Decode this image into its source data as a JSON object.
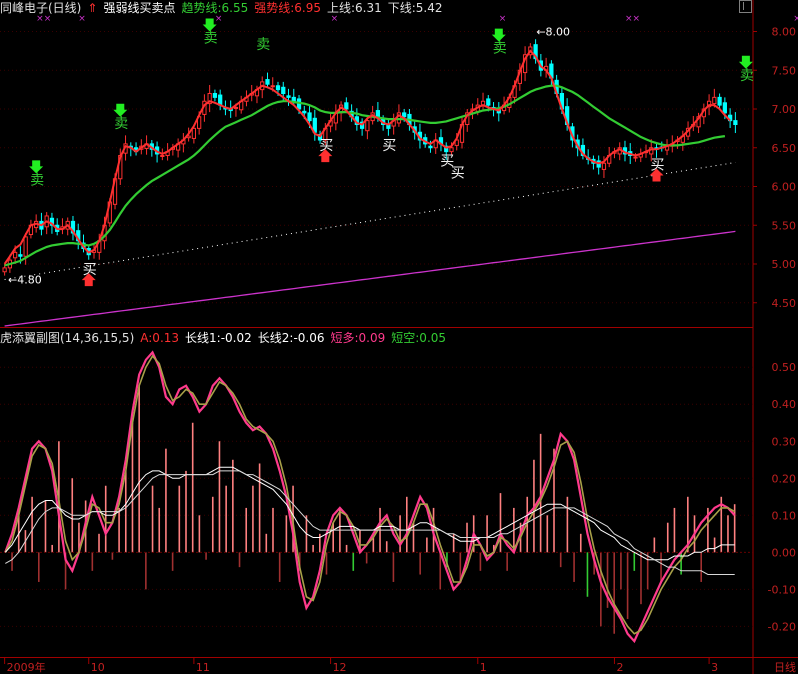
{
  "header": {
    "stock": "同峰电子(日线)",
    "indicator": "强弱线买卖点",
    "trend_label": "趋势线:6.55",
    "strong_label": "强势线:6.95",
    "upper_label": "上线:6.31",
    "lower_label": "下线:5.42"
  },
  "subheader": {
    "name": "虎添翼副图(14,36,15,5)",
    "a": "A:0.13",
    "long1": "长线1:-0.02",
    "long2": "长线2:-0.06",
    "short_long": "短多:0.09",
    "short_short": "短空:0.05"
  },
  "colors": {
    "up": "#ff3030",
    "down": "#00ffff",
    "trend": "#33cc33",
    "strong": "#ff3030",
    "purple": "#cc33cc",
    "white": "#ffffff",
    "pink": "#ff3a8c",
    "olive": "#a8a048",
    "label": "#f0f0f0",
    "buy_arrow": "#ff3030",
    "sell_arrow": "#22ee22"
  },
  "chart_data": [
    {
      "type": "candlestick",
      "title": "强弱线买卖点",
      "ylim": [
        4.2,
        8.2
      ],
      "y_ticks": [
        "8.00",
        "7.50",
        "7.00",
        "6.50",
        "6.00",
        "5.50",
        "5.00",
        "4.50"
      ],
      "x_ticks": [
        "2009年",
        "10",
        "11",
        "12",
        "1",
        "2",
        "3"
      ],
      "x_tick_index": [
        0,
        16,
        36,
        62,
        90,
        116,
        134
      ],
      "high_marker": "8.00",
      "low_marker": "4.80",
      "signals": [
        {
          "label": "卖",
          "index": 6,
          "value": 5.95,
          "arrow": "sell"
        },
        {
          "label": "买",
          "index": 16,
          "value": 5.05,
          "arrow": "buy"
        },
        {
          "label": "卖",
          "index": 22,
          "value": 6.68,
          "arrow": "sell"
        },
        {
          "label": "卖",
          "index": 39,
          "value": 7.78,
          "arrow": "sell"
        },
        {
          "label": "卖",
          "index": 49,
          "value": 7.7,
          "arrow": "none"
        },
        {
          "label": "买",
          "index": 61,
          "value": 6.65,
          "arrow": "buy"
        },
        {
          "label": "买",
          "index": 73,
          "value": 6.65,
          "arrow": "none"
        },
        {
          "label": "买",
          "index": 84,
          "value": 6.45,
          "arrow": "none"
        },
        {
          "label": "买",
          "index": 86,
          "value": 6.3,
          "arrow": "none"
        },
        {
          "label": "卖",
          "index": 94,
          "value": 7.65,
          "arrow": "sell"
        },
        {
          "label": "买",
          "index": 124,
          "value": 6.4,
          "arrow": "buy"
        },
        {
          "label": "卖",
          "index": 141,
          "value": 7.3,
          "arrow": "sell"
        }
      ],
      "close": [
        4.95,
        5.05,
        5.15,
        5.1,
        5.35,
        5.5,
        5.55,
        5.45,
        5.62,
        5.5,
        5.42,
        5.48,
        5.55,
        5.4,
        5.3,
        5.2,
        5.12,
        5.18,
        5.3,
        5.5,
        5.8,
        6.1,
        6.4,
        6.55,
        6.5,
        6.45,
        6.52,
        6.55,
        6.48,
        6.42,
        6.4,
        6.45,
        6.5,
        6.55,
        6.6,
        6.65,
        6.75,
        6.9,
        7.1,
        7.2,
        7.15,
        7.05,
        7.0,
        6.98,
        7.02,
        7.1,
        7.15,
        7.2,
        7.25,
        7.35,
        7.32,
        7.3,
        7.25,
        7.2,
        7.15,
        7.1,
        7.0,
        6.95,
        6.85,
        6.7,
        6.6,
        6.75,
        6.85,
        6.95,
        7.05,
        7.0,
        6.9,
        6.8,
        6.75,
        6.85,
        6.95,
        6.9,
        6.8,
        6.75,
        6.85,
        6.95,
        6.9,
        6.8,
        6.7,
        6.6,
        6.55,
        6.5,
        6.6,
        6.55,
        6.45,
        6.5,
        6.6,
        6.8,
        6.95,
        7.0,
        7.05,
        7.1,
        7.05,
        7.0,
        6.95,
        7.05,
        7.15,
        7.3,
        7.5,
        7.7,
        7.8,
        7.65,
        7.5,
        7.55,
        7.4,
        7.2,
        7.0,
        6.8,
        6.6,
        6.5,
        6.4,
        6.35,
        6.3,
        6.25,
        6.3,
        6.4,
        6.45,
        6.5,
        6.42,
        6.4,
        6.38,
        6.42,
        6.45,
        6.5,
        6.48,
        6.5,
        6.52,
        6.55,
        6.6,
        6.65,
        6.75,
        6.8,
        6.9,
        7.0,
        7.1,
        7.15,
        7.05,
        6.95,
        6.85,
        6.8
      ],
      "strong_line": [
        5.0,
        5.1,
        5.2,
        5.25,
        5.38,
        5.5,
        5.52,
        5.5,
        5.55,
        5.52,
        5.45,
        5.45,
        5.5,
        5.42,
        5.32,
        5.22,
        5.15,
        5.18,
        5.3,
        5.5,
        5.8,
        6.1,
        6.38,
        6.52,
        6.5,
        6.45,
        6.5,
        6.55,
        6.5,
        6.45,
        6.42,
        6.45,
        6.5,
        6.55,
        6.6,
        6.68,
        6.78,
        6.92,
        7.05,
        7.1,
        7.08,
        7.05,
        7.02,
        7.0,
        7.05,
        7.1,
        7.15,
        7.2,
        7.25,
        7.3,
        7.28,
        7.25,
        7.2,
        7.15,
        7.1,
        7.05,
        6.98,
        6.9,
        6.8,
        6.68,
        6.65,
        6.75,
        6.85,
        6.95,
        7.02,
        6.98,
        6.9,
        6.82,
        6.8,
        6.88,
        6.92,
        6.88,
        6.82,
        6.8,
        6.85,
        6.92,
        6.88,
        6.8,
        6.72,
        6.62,
        6.58,
        6.55,
        6.6,
        6.55,
        6.5,
        6.52,
        6.62,
        6.8,
        6.92,
        6.98,
        7.02,
        7.05,
        7.02,
        7.0,
        6.98,
        7.05,
        7.15,
        7.3,
        7.48,
        7.65,
        7.75,
        7.68,
        7.55,
        7.5,
        7.4,
        7.2,
        7.0,
        6.82,
        6.65,
        6.52,
        6.42,
        6.36,
        6.32,
        6.3,
        6.32,
        6.4,
        6.45,
        6.48,
        6.44,
        6.42,
        6.4,
        6.42,
        6.45,
        6.48,
        6.48,
        6.5,
        6.52,
        6.55,
        6.6,
        6.65,
        6.72,
        6.8,
        6.88,
        6.98,
        7.05,
        7.05,
        7.0,
        6.92,
        6.85
      ],
      "trend_line": [
        4.98,
        5.0,
        5.02,
        5.04,
        5.08,
        5.12,
        5.16,
        5.19,
        5.22,
        5.24,
        5.25,
        5.26,
        5.27,
        5.27,
        5.26,
        5.25,
        5.24,
        5.26,
        5.3,
        5.36,
        5.44,
        5.54,
        5.65,
        5.75,
        5.83,
        5.9,
        5.96,
        6.02,
        6.07,
        6.11,
        6.15,
        6.19,
        6.23,
        6.27,
        6.31,
        6.35,
        6.4,
        6.46,
        6.53,
        6.6,
        6.66,
        6.72,
        6.77,
        6.8,
        6.83,
        6.86,
        6.89,
        6.92,
        6.96,
        7.0,
        7.04,
        7.07,
        7.09,
        7.1,
        7.1,
        7.09,
        7.08,
        7.07,
        7.05,
        7.02,
        6.98,
        6.96,
        6.95,
        6.95,
        6.96,
        6.96,
        6.95,
        6.94,
        6.92,
        6.91,
        6.9,
        6.89,
        6.88,
        6.87,
        6.87,
        6.87,
        6.87,
        6.86,
        6.85,
        6.84,
        6.83,
        6.82,
        6.82,
        6.83,
        6.84,
        6.86,
        6.88,
        6.9,
        6.92,
        6.94,
        6.96,
        6.98,
        6.99,
        7.0,
        7.01,
        7.03,
        7.06,
        7.1,
        7.14,
        7.18,
        7.22,
        7.25,
        7.27,
        7.29,
        7.3,
        7.3,
        7.28,
        7.25,
        7.22,
        7.18,
        7.13,
        7.08,
        7.03,
        6.98,
        6.93,
        6.88,
        6.84,
        6.8,
        6.76,
        6.72,
        6.68,
        6.64,
        6.61,
        6.58,
        6.56,
        6.54,
        6.53,
        6.53,
        6.53,
        6.54,
        6.55,
        6.56,
        6.57,
        6.59,
        6.61,
        6.63,
        6.64,
        6.65
      ],
      "upper_line": [
        4.8,
        6.31
      ],
      "lower_line": [
        4.2,
        5.42
      ]
    },
    {
      "type": "oscillator",
      "title": "虎添翼副图(14,36,15,5)",
      "ylim": [
        -0.28,
        0.56
      ],
      "y_ticks": [
        "0.50",
        "0.40",
        "0.30",
        "0.20",
        "0.10",
        "0.00",
        "-0.10",
        "-0.20"
      ],
      "series": [
        {
          "name": "短多",
          "values": [
            0.0,
            0.05,
            0.12,
            0.2,
            0.28,
            0.3,
            0.28,
            0.22,
            0.1,
            -0.02,
            -0.05,
            0.0,
            0.08,
            0.15,
            0.1,
            0.05,
            0.08,
            0.15,
            0.25,
            0.38,
            0.48,
            0.52,
            0.54,
            0.5,
            0.42,
            0.4,
            0.44,
            0.45,
            0.42,
            0.38,
            0.4,
            0.45,
            0.47,
            0.45,
            0.42,
            0.38,
            0.35,
            0.33,
            0.34,
            0.32,
            0.28,
            0.22,
            0.15,
            0.05,
            -0.08,
            -0.15,
            -0.12,
            -0.05,
            0.05,
            0.1,
            0.12,
            0.1,
            0.05,
            0.0,
            0.02,
            0.05,
            0.08,
            0.1,
            0.05,
            0.02,
            0.05,
            0.1,
            0.15,
            0.12,
            0.05,
            0.0,
            -0.05,
            -0.1,
            -0.08,
            -0.02,
            0.05,
            0.02,
            -0.02,
            0.0,
            0.05,
            0.02,
            0.0,
            0.05,
            0.1,
            0.12,
            0.15,
            0.2,
            0.25,
            0.32,
            0.3,
            0.25,
            0.15,
            0.05,
            -0.02,
            -0.08,
            -0.12,
            -0.15,
            -0.18,
            -0.22,
            -0.24,
            -0.2,
            -0.16,
            -0.12,
            -0.08,
            -0.05,
            -0.02,
            0.0,
            0.02,
            0.05,
            0.08,
            0.1,
            0.12,
            0.13,
            0.12,
            0.1
          ]
        },
        {
          "name": "短空",
          "values": [
            0.0,
            0.03,
            0.1,
            0.18,
            0.26,
            0.29,
            0.28,
            0.24,
            0.14,
            0.03,
            -0.02,
            0.0,
            0.06,
            0.13,
            0.12,
            0.08,
            0.08,
            0.13,
            0.22,
            0.35,
            0.45,
            0.5,
            0.53,
            0.51,
            0.45,
            0.41,
            0.42,
            0.44,
            0.43,
            0.4,
            0.4,
            0.43,
            0.46,
            0.45,
            0.43,
            0.4,
            0.36,
            0.34,
            0.33,
            0.32,
            0.3,
            0.25,
            0.18,
            0.08,
            -0.04,
            -0.12,
            -0.13,
            -0.08,
            0.02,
            0.08,
            0.11,
            0.1,
            0.07,
            0.02,
            0.02,
            0.04,
            0.07,
            0.09,
            0.07,
            0.03,
            0.04,
            0.08,
            0.13,
            0.13,
            0.08,
            0.02,
            -0.03,
            -0.08,
            -0.08,
            -0.04,
            0.02,
            0.02,
            -0.01,
            0.0,
            0.04,
            0.03,
            0.01,
            0.04,
            0.08,
            0.11,
            0.14,
            0.18,
            0.23,
            0.29,
            0.3,
            0.27,
            0.19,
            0.09,
            0.01,
            -0.05,
            -0.1,
            -0.14,
            -0.17,
            -0.2,
            -0.22,
            -0.21,
            -0.18,
            -0.14,
            -0.1,
            -0.07,
            -0.04,
            -0.02,
            0.01,
            0.03,
            0.06,
            0.08,
            0.1,
            0.12,
            0.12,
            0.11
          ]
        },
        {
          "name": "长线1",
          "values": [
            0.0,
            0.02,
            0.05,
            0.08,
            0.11,
            0.13,
            0.14,
            0.14,
            0.12,
            0.1,
            0.09,
            0.09,
            0.1,
            0.11,
            0.11,
            0.1,
            0.1,
            0.11,
            0.13,
            0.16,
            0.19,
            0.21,
            0.22,
            0.22,
            0.21,
            0.2,
            0.2,
            0.21,
            0.21,
            0.21,
            0.21,
            0.22,
            0.23,
            0.23,
            0.23,
            0.22,
            0.21,
            0.2,
            0.19,
            0.18,
            0.17,
            0.15,
            0.13,
            0.1,
            0.07,
            0.05,
            0.04,
            0.04,
            0.05,
            0.06,
            0.07,
            0.07,
            0.07,
            0.06,
            0.06,
            0.06,
            0.07,
            0.07,
            0.07,
            0.06,
            0.06,
            0.07,
            0.08,
            0.08,
            0.07,
            0.06,
            0.05,
            0.04,
            0.03,
            0.03,
            0.03,
            0.04,
            0.04,
            0.05,
            0.06,
            0.07,
            0.08,
            0.09,
            0.1,
            0.11,
            0.12,
            0.13,
            0.13,
            0.13,
            0.12,
            0.11,
            0.1,
            0.09,
            0.08,
            0.06,
            0.05,
            0.04,
            0.02,
            0.01,
            0.0,
            -0.01,
            -0.02,
            -0.02,
            -0.02,
            -0.02,
            -0.01,
            -0.01,
            -0.01,
            0.0,
            0.0,
            0.01,
            0.01,
            0.02,
            0.02,
            0.02
          ]
        },
        {
          "name": "长线2",
          "values": [
            -0.03,
            -0.02,
            0.0,
            0.03,
            0.06,
            0.09,
            0.11,
            0.12,
            0.12,
            0.11,
            0.1,
            0.1,
            0.1,
            0.11,
            0.11,
            0.11,
            0.11,
            0.11,
            0.12,
            0.14,
            0.16,
            0.18,
            0.2,
            0.21,
            0.21,
            0.21,
            0.21,
            0.21,
            0.21,
            0.21,
            0.21,
            0.21,
            0.22,
            0.22,
            0.22,
            0.22,
            0.21,
            0.21,
            0.2,
            0.19,
            0.18,
            0.17,
            0.15,
            0.13,
            0.11,
            0.09,
            0.07,
            0.06,
            0.06,
            0.06,
            0.06,
            0.06,
            0.06,
            0.06,
            0.06,
            0.06,
            0.06,
            0.06,
            0.06,
            0.06,
            0.06,
            0.06,
            0.06,
            0.06,
            0.06,
            0.06,
            0.05,
            0.05,
            0.04,
            0.04,
            0.04,
            0.04,
            0.04,
            0.04,
            0.05,
            0.05,
            0.06,
            0.07,
            0.08,
            0.09,
            0.1,
            0.11,
            0.12,
            0.12,
            0.12,
            0.12,
            0.11,
            0.1,
            0.09,
            0.08,
            0.07,
            0.05,
            0.04,
            0.03,
            0.01,
            0.0,
            -0.01,
            -0.02,
            -0.03,
            -0.04,
            -0.04,
            -0.05,
            -0.05,
            -0.05,
            -0.05,
            -0.06,
            -0.06,
            -0.06,
            -0.06,
            -0.06
          ]
        },
        {
          "name": "A",
          "values": [
            0.0,
            -0.05,
            0.12,
            0.06,
            0.15,
            -0.08,
            0.14,
            0.02,
            0.3,
            -0.1,
            0.2,
            0.08,
            0.14,
            -0.05,
            0.05,
            0.18,
            -0.02,
            0.12,
            0.22,
            0.35,
            0.45,
            -0.1,
            0.18,
            0.12,
            0.28,
            -0.05,
            0.18,
            0.22,
            0.35,
            0.1,
            -0.02,
            0.15,
            0.3,
            0.18,
            0.25,
            -0.04,
            0.12,
            0.18,
            0.24,
            0.05,
            0.12,
            -0.08,
            0.1,
            0.18,
            -0.05,
            0.1,
            0.02,
            0.05,
            -0.06,
            0.08,
            0.12,
            0.02,
            -0.05,
            0.06,
            -0.03,
            0.04,
            0.12,
            0.03,
            -0.08,
            0.1,
            0.15,
            0.08,
            -0.06,
            0.04,
            0.12,
            -0.1,
            -0.04,
            0.05,
            -0.08,
            0.08,
            0.1,
            -0.05,
            0.1,
            0.02,
            0.16,
            -0.05,
            0.12,
            0.08,
            0.15,
            0.25,
            0.32,
            0.1,
            0.28,
            -0.04,
            0.15,
            -0.08,
            0.05,
            -0.12,
            -0.06,
            -0.2,
            -0.15,
            -0.22,
            -0.1,
            -0.18,
            -0.05,
            -0.14,
            -0.1,
            0.04,
            -0.08,
            0.08,
            0.12,
            -0.06,
            0.15,
            0.1,
            -0.08,
            0.12,
            0.04,
            0.15,
            0.1,
            0.13
          ]
        }
      ]
    }
  ]
}
